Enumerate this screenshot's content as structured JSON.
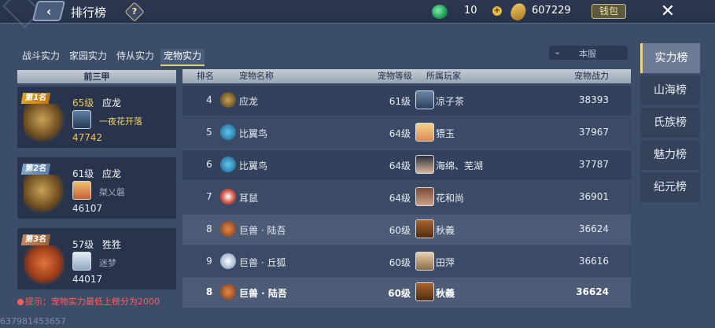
{
  "header": {
    "back_icon": "chevron-left-icon",
    "title": "排行榜",
    "help_label": "?",
    "jade": {
      "icon": "jade-icon",
      "value": "10"
    },
    "gold": {
      "icon": "gold-ingot-icon",
      "value": "607229"
    },
    "wallet_label": "钱包",
    "close_icon": "close-icon"
  },
  "category_tabs": [
    {
      "label": "战斗实力",
      "active": false
    },
    {
      "label": "家园实力",
      "active": false
    },
    {
      "label": "侍从实力",
      "active": false
    },
    {
      "label": "宠物实力",
      "active": true
    }
  ],
  "server_filter": {
    "value": "本服"
  },
  "top3": {
    "header": "前三甲",
    "cards": [
      {
        "rank": "第1名",
        "level": "65级",
        "pet": "应龙",
        "player": "一夜花开落",
        "power": "47742"
      },
      {
        "rank": "第2名",
        "level": "61级",
        "pet": "应龙",
        "player": "桀乂磐",
        "power": "46107"
      },
      {
        "rank": "第3名",
        "level": "57级",
        "pet": "狌狌",
        "player": "迷梦",
        "power": "44017"
      }
    ]
  },
  "tip": "提示：宠物实力最低上榜分为2000",
  "table": {
    "headers": {
      "rank": "排名",
      "name": "宠物名称",
      "level": "宠物等级",
      "owner": "所属玩家",
      "power": "宠物战力"
    },
    "rows": [
      {
        "rank": "4",
        "name": "应龙",
        "level": "61级",
        "owner": "凉子茶",
        "power": "38393"
      },
      {
        "rank": "5",
        "name": "比翼鸟",
        "level": "64级",
        "owner": "猥玉",
        "power": "37967"
      },
      {
        "rank": "6",
        "name": "比翼鸟",
        "level": "64级",
        "owner": "海绵、芜湖",
        "power": "37787"
      },
      {
        "rank": "7",
        "name": "耳鼠",
        "level": "64级",
        "owner": "花和尚",
        "power": "36901"
      },
      {
        "rank": "8",
        "name": "巨兽 · 陆吾",
        "level": "60级",
        "owner": "秋義",
        "power": "36624"
      },
      {
        "rank": "9",
        "name": "巨兽 · 丘狐",
        "level": "60级",
        "owner": "田萍",
        "power": "36616"
      }
    ],
    "self_row": {
      "rank": "8",
      "name": "巨兽 · 陆吾",
      "level": "60级",
      "owner": "秋義",
      "power": "36624"
    }
  },
  "side_tabs": [
    {
      "label": "实力榜",
      "active": true
    },
    {
      "label": "山海榜",
      "active": false
    },
    {
      "label": "氏族榜",
      "active": false
    },
    {
      "label": "魅力榜",
      "active": false
    },
    {
      "label": "纪元榜",
      "active": false
    }
  ],
  "footer_id": "637981453657",
  "colors": {
    "accent_gold": "#f0c45a",
    "tip_red": "#ff5d5d",
    "bg": "#3c4d68"
  }
}
